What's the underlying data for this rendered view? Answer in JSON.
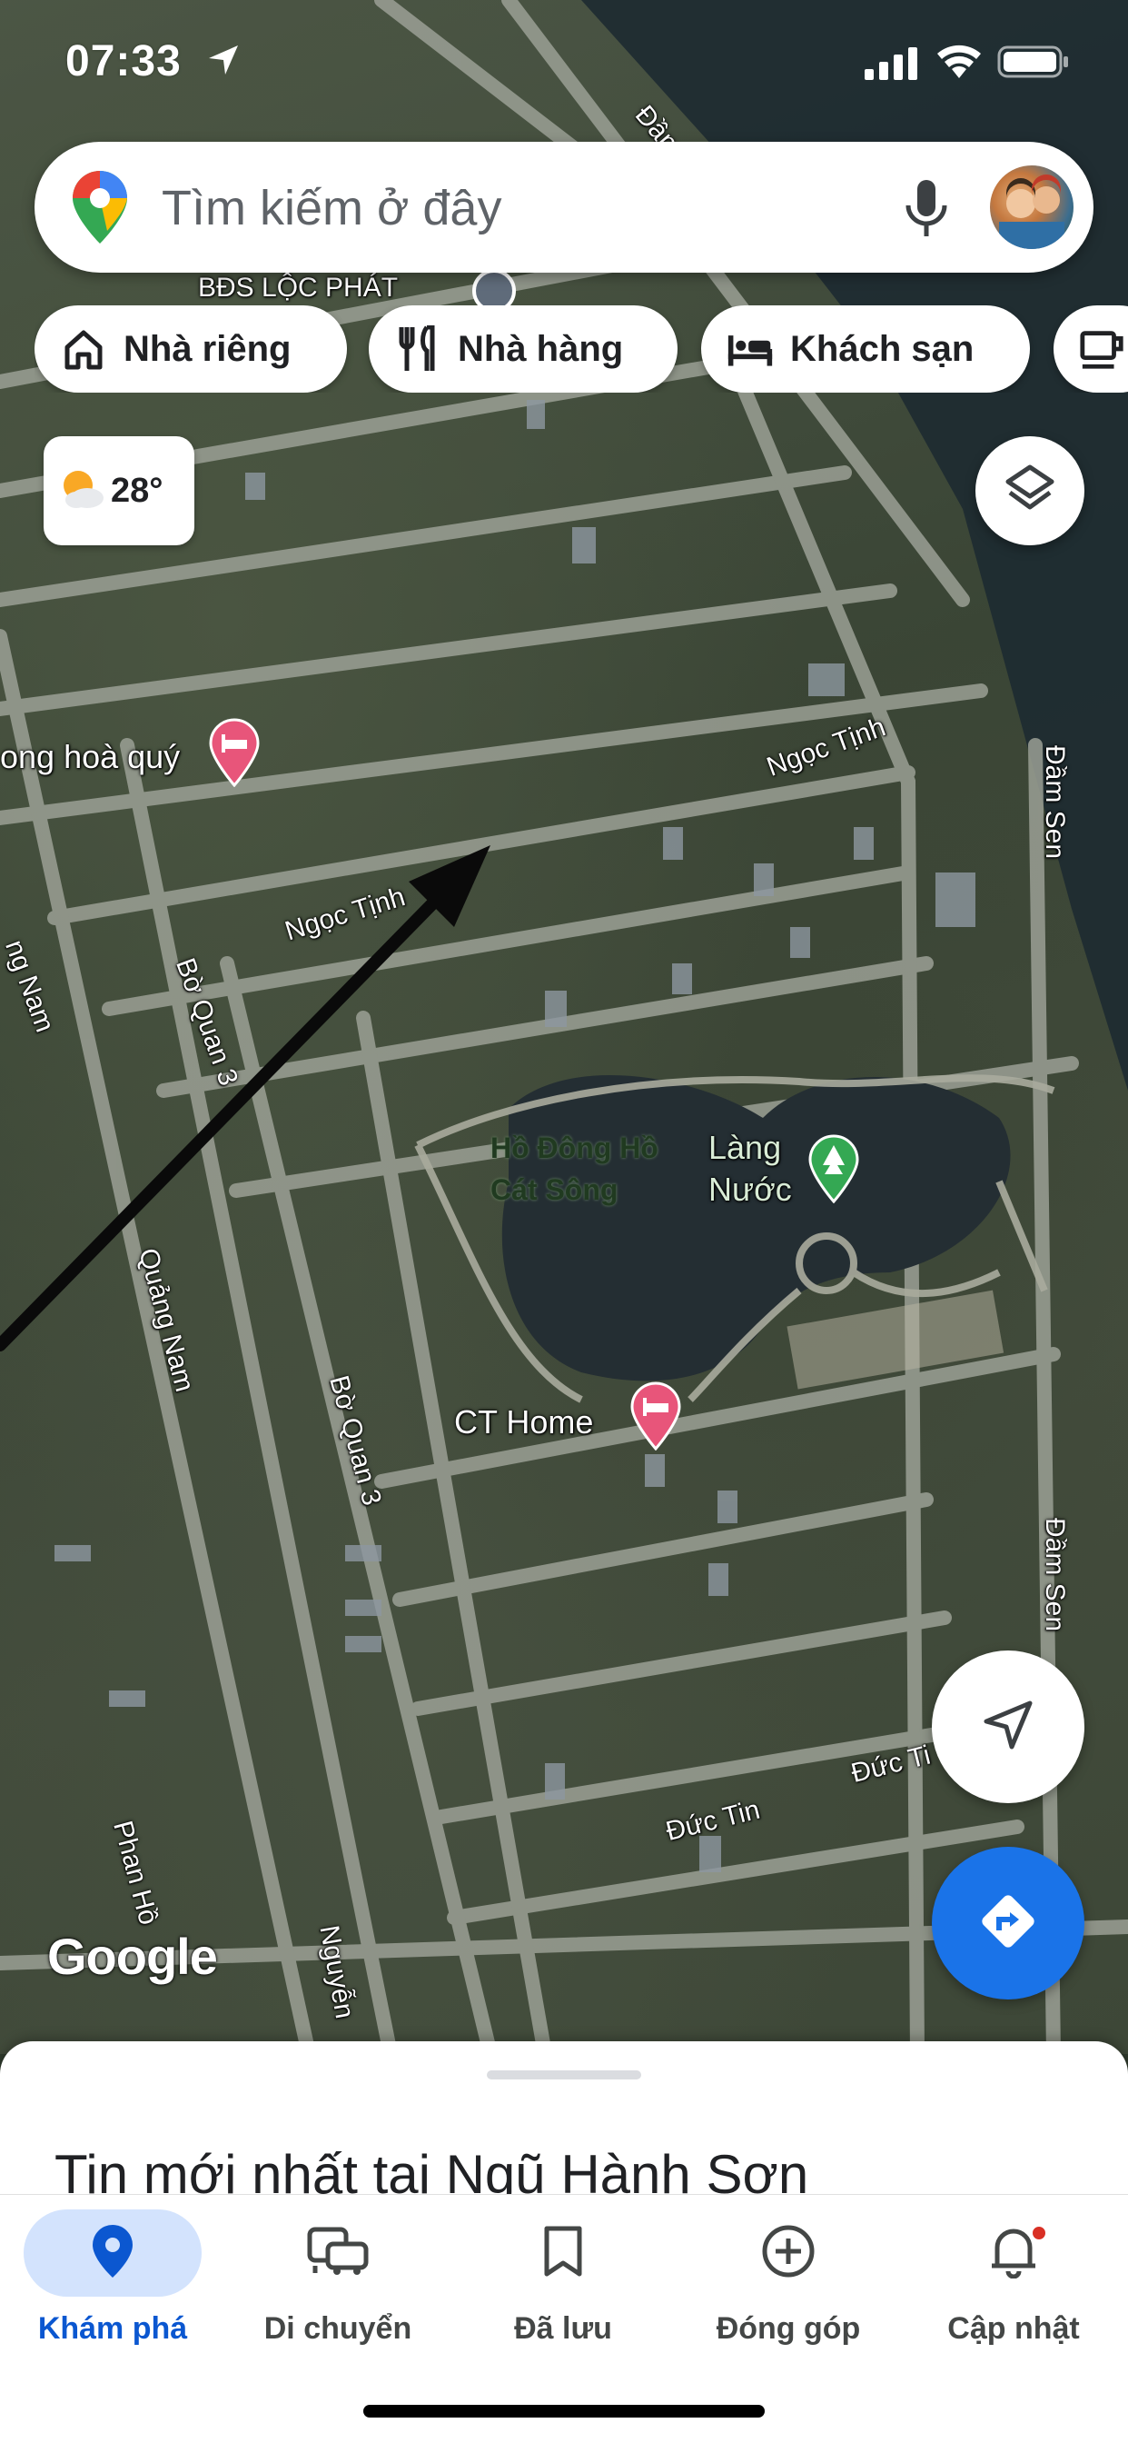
{
  "status_bar": {
    "time": "07:33"
  },
  "search": {
    "placeholder": "Tìm kiếm ở đây"
  },
  "chips": [
    {
      "label": "Nhà riêng",
      "icon": "home-icon"
    },
    {
      "label": "Nhà hàng",
      "icon": "restaurant-icon"
    },
    {
      "label": "Khách sạn",
      "icon": "hotel-icon"
    },
    {
      "label": "",
      "icon": "coffee-icon"
    }
  ],
  "weather": {
    "temperature": "28°",
    "icon": "partly-cloudy-icon"
  },
  "map": {
    "labels": {
      "bds": "BĐS LỘC PHÁT",
      "dam_top": "Đầm",
      "hoa_quy": "ong hoà quý",
      "ngoc_tinh_1": "Ngọc Tịnh",
      "ngoc_tinh_2": "Ngọc Tịnh",
      "dam_sen_1": "Đầm Sen",
      "dam_sen_2": "Đầm Sen",
      "bo_quan_3a": "Bờ Quan 3",
      "bo_quan_3b": "Bờ Quan 3",
      "quang_nam_1": "ng Nam",
      "quang_nam_2": "Quảng Nam",
      "lake_dark": "Hồ Đông Hồ\nCát Sông",
      "lake": "Làng\nNước",
      "ct_home": "CT Home",
      "duc_tin_1": "Đức Tin",
      "duc_tin_2": "Đức Ti",
      "phan_ho": "Phan Hồ",
      "nguyen": "Nguyễn"
    },
    "logo": "Google"
  },
  "bottom_sheet": {
    "title": "Tin mới nhất tại Ngũ Hành Sơn"
  },
  "nav": [
    {
      "label": "Khám phá",
      "icon": "explore-pin-icon",
      "active": true
    },
    {
      "label": "Di chuyển",
      "icon": "commute-icon",
      "active": false
    },
    {
      "label": "Đã lưu",
      "icon": "bookmark-icon",
      "active": false
    },
    {
      "label": "Đóng góp",
      "icon": "add-circle-icon",
      "active": false
    },
    {
      "label": "Cập nhật",
      "icon": "bell-icon",
      "active": false,
      "has_notification": true
    }
  ],
  "colors": {
    "accent": "#1a73e8",
    "nav_active": "#0b57d0",
    "nav_active_bg": "#d3e3fd",
    "notification": "#d93025",
    "hotel_pin": "#e8557a",
    "park_pin": "#34a853"
  }
}
